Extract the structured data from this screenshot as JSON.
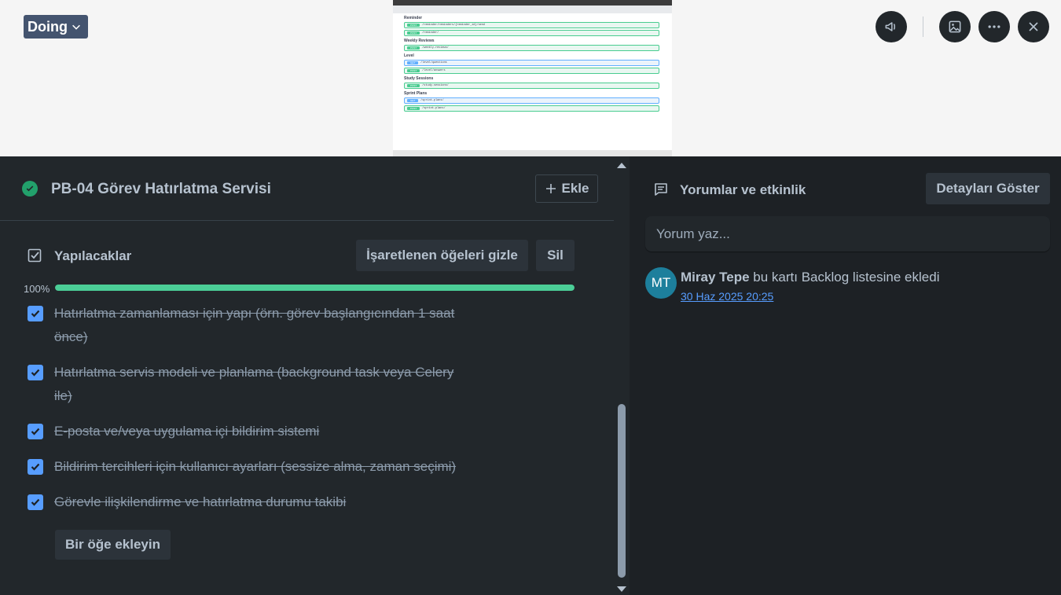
{
  "header": {
    "status_label": "Doing",
    "icons": [
      "megaphone-icon",
      "image-icon",
      "more-icon",
      "close-icon"
    ]
  },
  "cover": {
    "sections": [
      {
        "title": "Reminder",
        "rows": [
          {
            "method": "POST",
            "path": "/reminder/reminders/{reminder_id}/send"
          },
          {
            "method": "POST",
            "path": "/reminder/"
          }
        ]
      },
      {
        "title": "Weekly Reviews",
        "rows": [
          {
            "method": "POST",
            "path": "/weekly-reviews/"
          }
        ]
      },
      {
        "title": "Level",
        "rows": [
          {
            "method": "GET",
            "path": "/level/questions"
          },
          {
            "method": "POST",
            "path": "/level/answers"
          }
        ]
      },
      {
        "title": "Study Sessions",
        "rows": [
          {
            "method": "POST",
            "path": "/study-sessions/"
          }
        ]
      },
      {
        "title": "Sprint Plans",
        "rows": [
          {
            "method": "GET",
            "path": "/sprint-plans/"
          },
          {
            "method": "POST",
            "path": "/sprint-plans/"
          }
        ]
      }
    ]
  },
  "card": {
    "title": "PB-04 Görev Hatırlatma Servisi",
    "add_label": "Ekle"
  },
  "checklist": {
    "title": "Yapılacaklar",
    "hide_checked_label": "İşaretlenen öğeleri gizle",
    "delete_label": "Sil",
    "progress_label": "100%",
    "progress": 1.0,
    "items": [
      {
        "text": "Hatırlatma zamanlaması için yapı (örn. görev başlangıcından 1 saat önce)",
        "checked": true
      },
      {
        "text": "Hatırlatma servis modeli ve planlama (background task veya Celery ile)",
        "checked": true
      },
      {
        "text": "E-posta ve/veya uygulama içi bildirim sistemi",
        "checked": true
      },
      {
        "text": "Bildirim tercihleri için kullanıcı ayarları (sessize alma, zaman seçimi)",
        "checked": true
      },
      {
        "text": "Görevle ilişkilendirme ve hatırlatma durumu takibi",
        "checked": true
      }
    ],
    "add_item_label": "Bir öğe ekleyin"
  },
  "activity": {
    "title": "Yorumlar ve etkinlik",
    "details_label": "Detayları Göster",
    "comment_placeholder": "Yorum yaz...",
    "entries": [
      {
        "avatar": "MT",
        "user": "Miray Tepe",
        "action": "bu kartı Backlog listesine ekledi",
        "date": "30 Haz 2025 20:25"
      }
    ]
  },
  "colors": {
    "progress": "#4bce97",
    "checkbox": "#579dff",
    "done_icon": "#22a06b",
    "avatar": "#1d7f9c"
  }
}
